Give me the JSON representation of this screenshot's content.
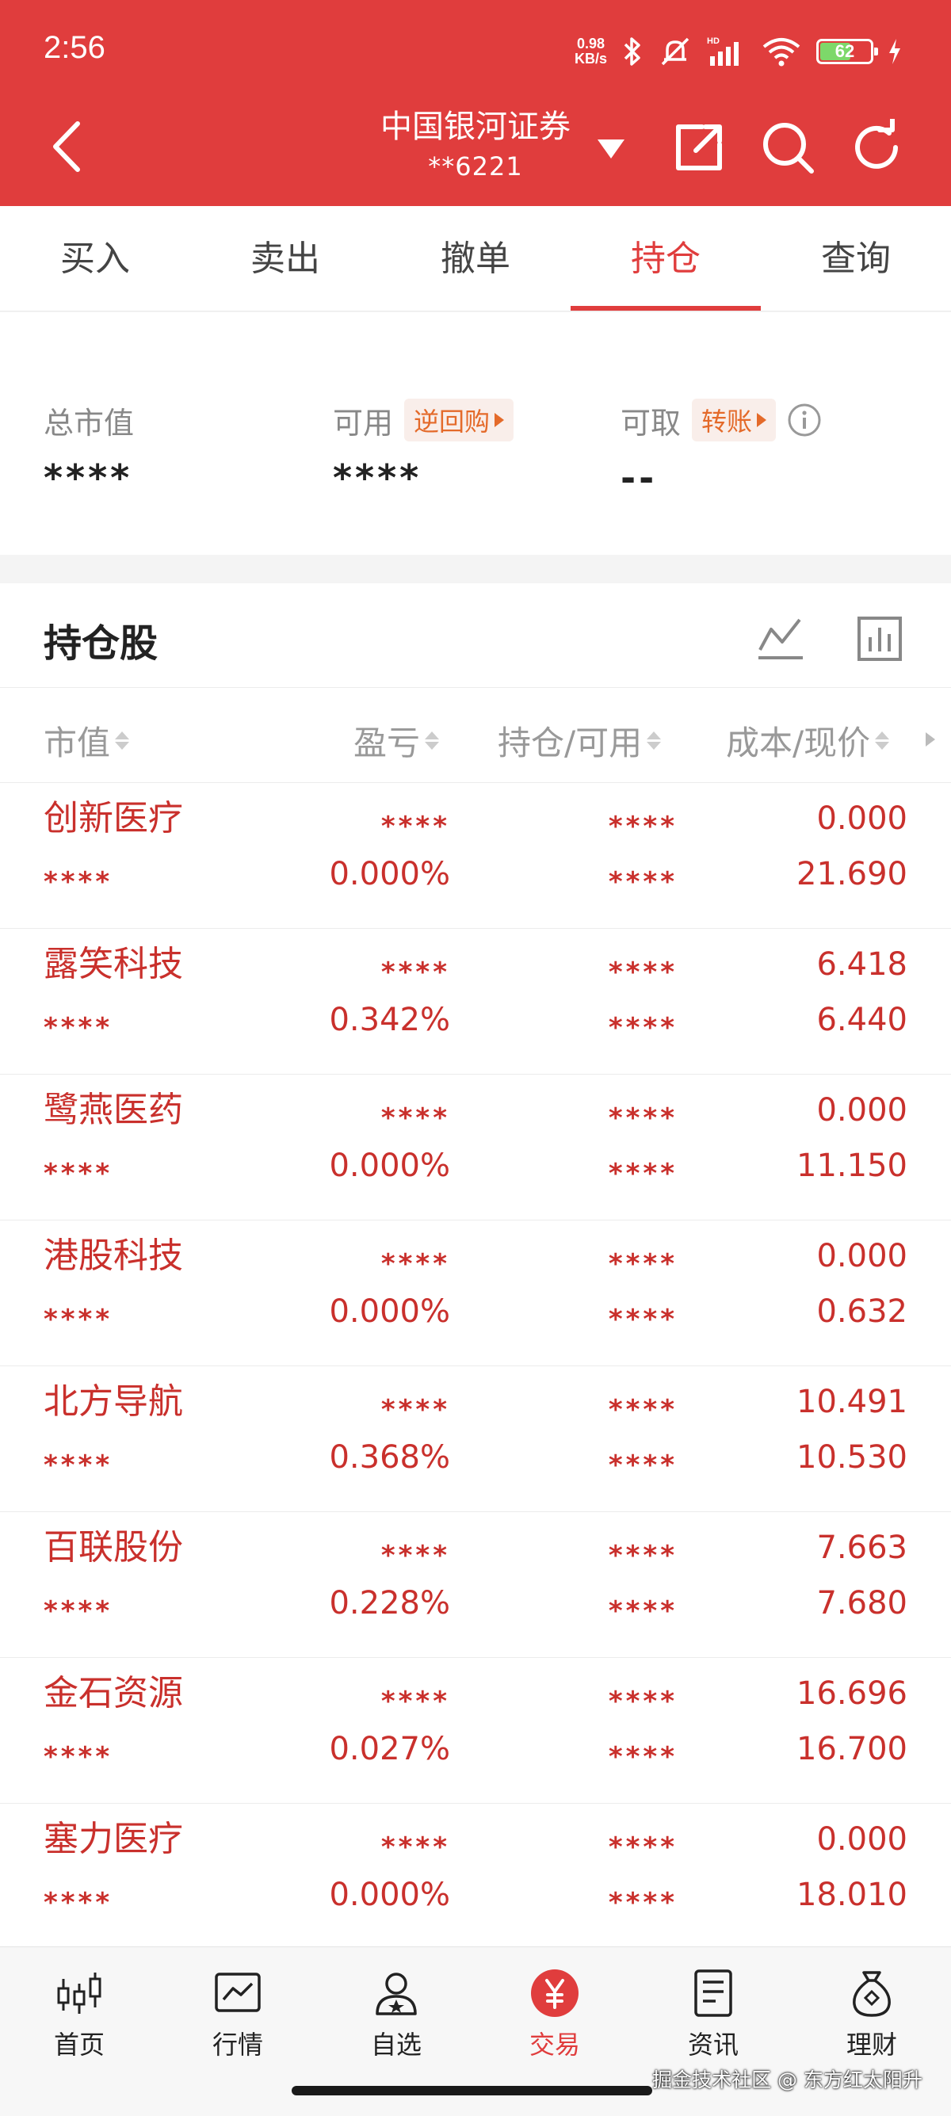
{
  "status_bar": {
    "time": "2:56",
    "net_speed_value": "0.98",
    "net_speed_unit": "KB/s",
    "battery": "62"
  },
  "header": {
    "title": "中国银河证券",
    "account": "**6221"
  },
  "tabs": [
    {
      "label": "买入"
    },
    {
      "label": "卖出"
    },
    {
      "label": "撤单"
    },
    {
      "label": "持仓"
    },
    {
      "label": "查询"
    }
  ],
  "summary": {
    "total_label": "总市值",
    "total_value": "****",
    "available_label": "可用",
    "available_badge": "逆回购",
    "available_value": "****",
    "withdraw_label": "可取",
    "withdraw_badge": "转账",
    "withdraw_value": "--"
  },
  "holdings": {
    "title": "持仓股",
    "columns": [
      "市值",
      "盈亏",
      "持仓/可用",
      "成本/现价"
    ],
    "rows": [
      {
        "name": "创新医疗",
        "market_value": "****",
        "pnl": "****",
        "pnl_pct": "0.000%",
        "position": "****",
        "available": "****",
        "cost": "0.000",
        "price": "21.690"
      },
      {
        "name": "露笑科技",
        "market_value": "****",
        "pnl": "****",
        "pnl_pct": "0.342%",
        "position": "****",
        "available": "****",
        "cost": "6.418",
        "price": "6.440"
      },
      {
        "name": "鹭燕医药",
        "market_value": "****",
        "pnl": "****",
        "pnl_pct": "0.000%",
        "position": "****",
        "available": "****",
        "cost": "0.000",
        "price": "11.150"
      },
      {
        "name": "港股科技",
        "market_value": "****",
        "pnl": "****",
        "pnl_pct": "0.000%",
        "position": "****",
        "available": "****",
        "cost": "0.000",
        "price": "0.632"
      },
      {
        "name": "北方导航",
        "market_value": "****",
        "pnl": "****",
        "pnl_pct": "0.368%",
        "position": "****",
        "available": "****",
        "cost": "10.491",
        "price": "10.530"
      },
      {
        "name": "百联股份",
        "market_value": "****",
        "pnl": "****",
        "pnl_pct": "0.228%",
        "position": "****",
        "available": "****",
        "cost": "7.663",
        "price": "7.680"
      },
      {
        "name": "金石资源",
        "market_value": "****",
        "pnl": "****",
        "pnl_pct": "0.027%",
        "position": "****",
        "available": "****",
        "cost": "16.696",
        "price": "16.700"
      },
      {
        "name": "塞力医疗",
        "market_value": "****",
        "pnl": "****",
        "pnl_pct": "0.000%",
        "position": "****",
        "available": "****",
        "cost": "0.000",
        "price": "18.010"
      }
    ]
  },
  "bottom_nav": [
    {
      "label": "首页",
      "icon": "candlestick-icon"
    },
    {
      "label": "行情",
      "icon": "market-chart-icon"
    },
    {
      "label": "自选",
      "icon": "user-star-icon"
    },
    {
      "label": "交易",
      "icon": "yuan-icon",
      "active": true
    },
    {
      "label": "资讯",
      "icon": "news-icon"
    },
    {
      "label": "理财",
      "icon": "money-bag-icon"
    }
  ],
  "watermark": "掘金技术社区 @ 东方红太阳升",
  "colors": {
    "brand_red": "#e03d3d",
    "stock_red": "#c9302c",
    "badge_orange": "#e46a2a"
  }
}
